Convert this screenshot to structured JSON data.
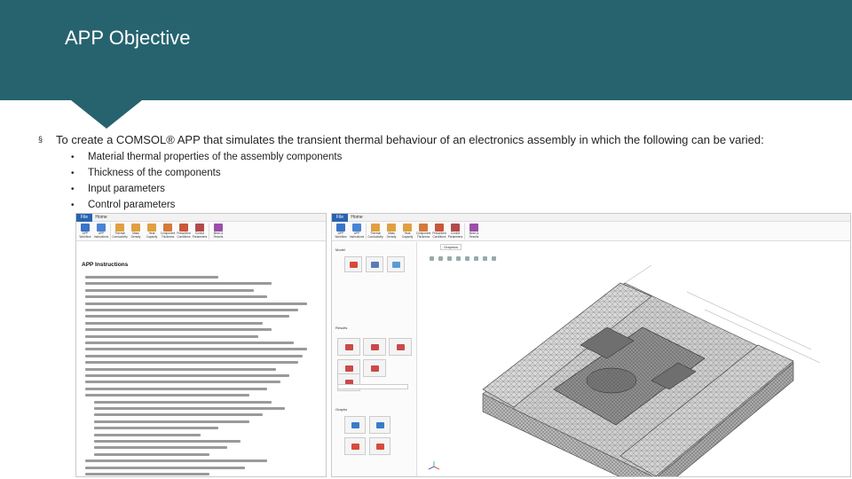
{
  "header": {
    "title": "APP Objective",
    "bg_color": "#26636f"
  },
  "objective": {
    "main_text": "To create a COMSOL® APP that simulates the transient thermal behaviour of an electronics assembly in which the following can be varied:",
    "bullet_marker": "§",
    "sub_marker": "•",
    "sub_items": [
      "Material thermal properties of the assembly components",
      "Thickness of the components",
      "Input parameters",
      "Control parameters"
    ]
  },
  "left_app": {
    "tabs": [
      "File",
      "Home"
    ],
    "ribbon_buttons": [
      {
        "label": "APP Workflow",
        "icon": "app-icon",
        "color": "#3b73c7"
      },
      {
        "label": "APP Instructions",
        "icon": "book-icon",
        "color": "#4a83d4"
      },
      {
        "label": "Thermal Conductivity",
        "icon": "thermal-icon",
        "color": "#e0a040"
      },
      {
        "label": "Mass Density",
        "icon": "density-icon",
        "color": "#e0a040"
      },
      {
        "label": "Heat Capacity",
        "icon": "heat-icon",
        "color": "#e0a040"
      },
      {
        "label": "Component Thickness",
        "icon": "layers-icon",
        "color": "#d47a3a"
      },
      {
        "label": "Prescribed Conditions",
        "icon": "conditions-icon",
        "color": "#c9573a"
      },
      {
        "label": "Control Parameters",
        "icon": "control-icon",
        "color": "#b24a4a"
      },
      {
        "label": "Mesh & Results",
        "icon": "mesh-icon",
        "color": "#9a4fa8"
      }
    ],
    "instructions_title": "APP Instructions"
  },
  "right_app": {
    "tabs": [
      "File",
      "Home"
    ],
    "ribbon_buttons": [
      {
        "label": "APP Workflow",
        "icon": "app-icon",
        "color": "#3b73c7"
      },
      {
        "label": "APP Instructions",
        "icon": "book-icon",
        "color": "#4a83d4"
      },
      {
        "label": "Thermal Conductivity",
        "icon": "thermal-icon",
        "color": "#e0a040"
      },
      {
        "label": "Mass Density",
        "icon": "density-icon",
        "color": "#e0a040"
      },
      {
        "label": "Heat Capacity",
        "icon": "heat-icon",
        "color": "#e0a040"
      },
      {
        "label": "Component Thickness",
        "icon": "layers-icon",
        "color": "#d47a3a"
      },
      {
        "label": "Prescribed Conditions",
        "icon": "conditions-icon",
        "color": "#c9573a"
      },
      {
        "label": "Control Parameters",
        "icon": "control-icon",
        "color": "#b24a4a"
      },
      {
        "label": "Mesh & Results",
        "icon": "mesh-icon",
        "color": "#9a4fa8"
      }
    ],
    "graphics_tab": "Graphics",
    "side_sections": [
      "Model",
      "Results",
      "Graphs"
    ]
  }
}
